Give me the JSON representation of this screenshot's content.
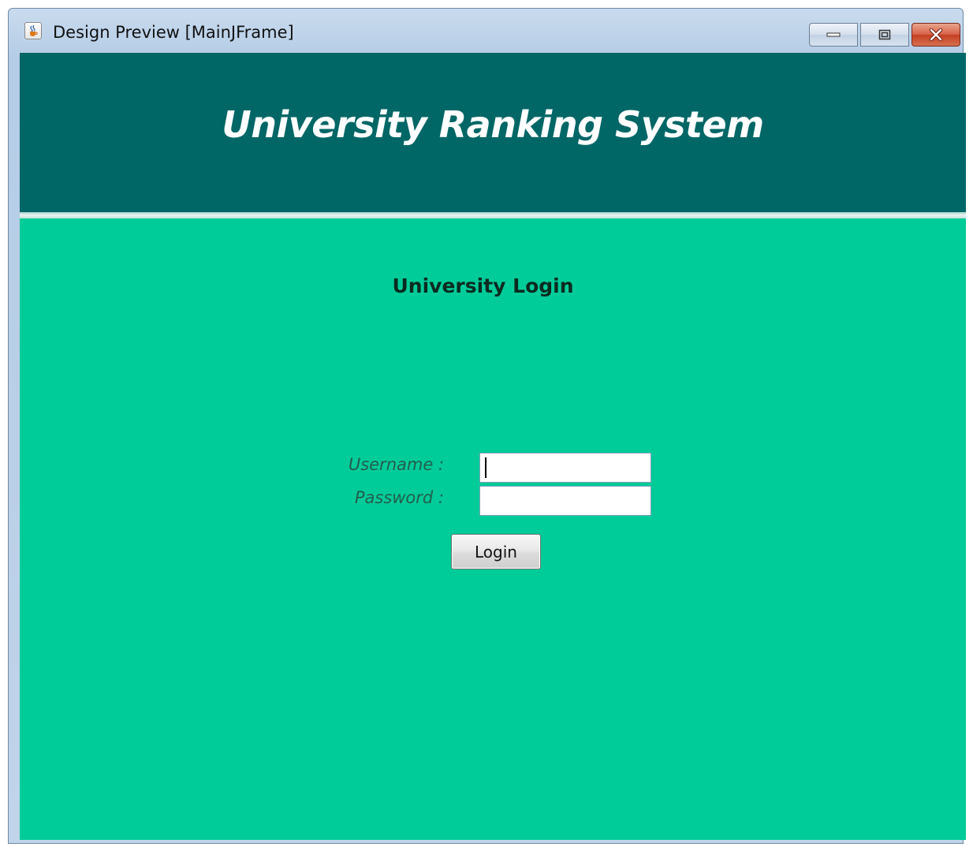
{
  "window": {
    "title": "Design Preview [MainJFrame]",
    "icon": "java-cup-icon",
    "controls": {
      "minimize_icon": "minimize-icon",
      "maximize_icon": "maximize-icon",
      "close_icon": "close-icon"
    }
  },
  "header": {
    "title": "University Ranking System",
    "background_color": "#006666"
  },
  "login": {
    "title": "University Login",
    "username_label": "Username :",
    "username_value": "",
    "password_label": "Password :",
    "password_value": "",
    "button_label": "Login",
    "background_color": "#00cc99"
  }
}
